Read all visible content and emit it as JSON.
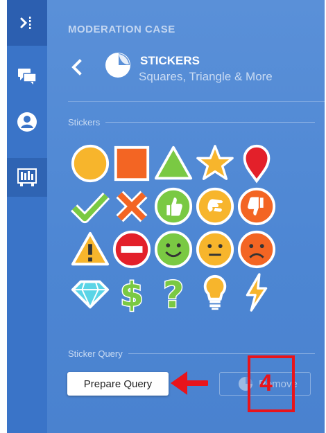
{
  "rail": {
    "items": [
      {
        "icon": "collapse-panel-icon"
      },
      {
        "icon": "chat-bubbles-icon"
      },
      {
        "icon": "user-icon"
      },
      {
        "icon": "sticker-board-icon"
      }
    ]
  },
  "panel": {
    "case_label": "MODERATION CASE",
    "title": "STICKERS",
    "subtitle": "Squares, Triangle & More",
    "stickers_section_label": "Stickers",
    "query_section_label": "Sticker Query",
    "prepare_button": "Prepare Query",
    "remove_button": "Remove"
  },
  "stickers": [
    {
      "name": "orange-circle"
    },
    {
      "name": "orange-square"
    },
    {
      "name": "green-triangle"
    },
    {
      "name": "yellow-star"
    },
    {
      "name": "red-pin"
    },
    {
      "name": "green-checkmark"
    },
    {
      "name": "red-x"
    },
    {
      "name": "thumbs-up"
    },
    {
      "name": "hand-stop"
    },
    {
      "name": "thumbs-down"
    },
    {
      "name": "warning-triangle"
    },
    {
      "name": "no-entry"
    },
    {
      "name": "smiley-happy"
    },
    {
      "name": "smiley-neutral"
    },
    {
      "name": "smiley-sad"
    },
    {
      "name": "diamond"
    },
    {
      "name": "dollar-sign"
    },
    {
      "name": "question-mark"
    },
    {
      "name": "light-bulb"
    },
    {
      "name": "lightning-bolt"
    }
  ],
  "annotation": {
    "step_number": "4",
    "color": "#e8141b"
  },
  "colors": {
    "rail": "#3a74c8",
    "panel": "#5089d5",
    "accent_orange": "#f7b52c",
    "accent_red": "#e3202a",
    "accent_green": "#7ac943"
  }
}
